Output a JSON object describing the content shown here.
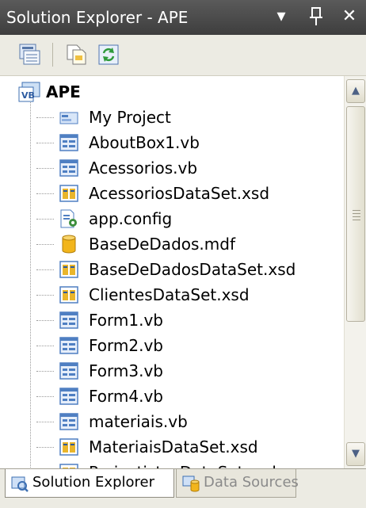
{
  "window": {
    "title": "Solution Explorer - APE",
    "dropdown_glyph": "▾",
    "pin_glyph": "‖",
    "close_glyph": "✕"
  },
  "toolbar": {
    "buttons": [
      {
        "name": "properties-icon"
      },
      {
        "name": "show-all-files-icon"
      },
      {
        "name": "refresh-icon"
      }
    ]
  },
  "tree": {
    "root": {
      "label": "APE",
      "icon": "vb-project-icon"
    },
    "items": [
      {
        "label": "My Project",
        "icon": "my-project-icon"
      },
      {
        "label": "AboutBox1.vb",
        "icon": "vb-form-icon"
      },
      {
        "label": "Acessorios.vb",
        "icon": "vb-form-icon"
      },
      {
        "label": "AcessoriosDataSet.xsd",
        "icon": "dataset-icon"
      },
      {
        "label": "app.config",
        "icon": "config-file-icon"
      },
      {
        "label": "BaseDeDados.mdf",
        "icon": "database-icon"
      },
      {
        "label": "BaseDeDadosDataSet.xsd",
        "icon": "dataset-icon"
      },
      {
        "label": "ClientesDataSet.xsd",
        "icon": "dataset-icon"
      },
      {
        "label": "Form1.vb",
        "icon": "vb-form-icon"
      },
      {
        "label": "Form2.vb",
        "icon": "vb-form-icon"
      },
      {
        "label": "Form3.vb",
        "icon": "vb-form-icon"
      },
      {
        "label": "Form4.vb",
        "icon": "vb-form-icon"
      },
      {
        "label": "materiais.vb",
        "icon": "vb-form-icon"
      },
      {
        "label": "MateriaisDataSet.xsd",
        "icon": "dataset-icon"
      },
      {
        "label": "ProjectistasDataSet.xsd",
        "icon": "dataset-icon"
      }
    ]
  },
  "scrollbar": {
    "up_glyph": "▲",
    "down_glyph": "▼"
  },
  "tabs": [
    {
      "label": "Solution Explorer",
      "active": true,
      "icon": "solution-explorer-icon"
    },
    {
      "label": "Data Sources",
      "active": false,
      "icon": "data-sources-icon"
    }
  ],
  "colors": {
    "titlebar": "#4a4a4a",
    "toolbar": "#ecebe3",
    "form_icon_blue": "#4f7fc2",
    "dataset_icon_yellow": "#e9b52b",
    "database_icon_gold": "#f2b51c"
  }
}
